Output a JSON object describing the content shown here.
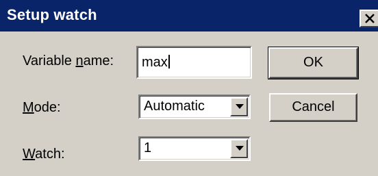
{
  "window": {
    "title": "Setup watch"
  },
  "fields": {
    "variable_name": {
      "label_pre": "Variable ",
      "label_key": "n",
      "label_post": "ame:",
      "value": "max"
    },
    "mode": {
      "label_pre": "",
      "label_key": "M",
      "label_post": "ode:",
      "value": "Automatic"
    },
    "watch": {
      "label_pre": "",
      "label_key": "W",
      "label_post": "atch:",
      "value": "1"
    }
  },
  "buttons": {
    "ok": "OK",
    "cancel": "Cancel"
  },
  "icons": {
    "close": "close-icon",
    "dropdown": "chevron-down-icon"
  }
}
